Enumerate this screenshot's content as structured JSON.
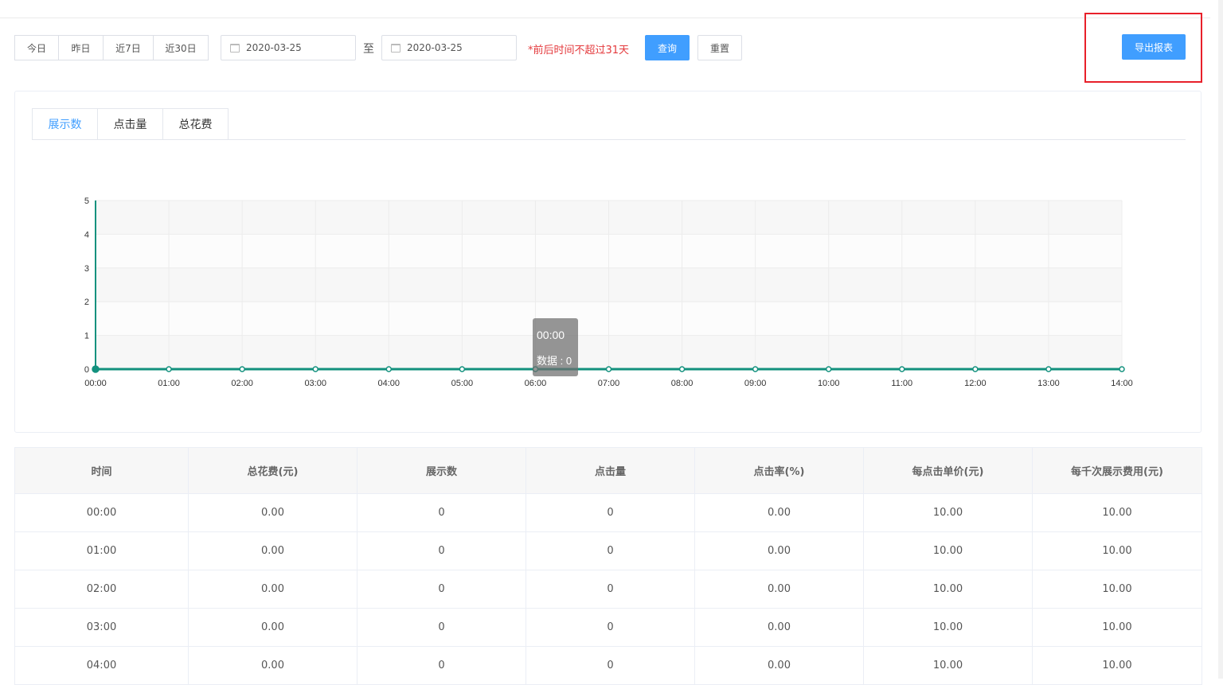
{
  "quick_dates": [
    "今日",
    "昨日",
    "近7日",
    "近30日"
  ],
  "date_range": {
    "start": "2020-03-25",
    "separator": "至",
    "end": "2020-03-25"
  },
  "warning": "*前后时间不超过31天",
  "buttons": {
    "query": "查询",
    "reset": "重置",
    "export": "导出报表"
  },
  "tabs": [
    {
      "label": "展示数",
      "active": true
    },
    {
      "label": "点击量",
      "active": false
    },
    {
      "label": "总花费",
      "active": false
    }
  ],
  "tooltip": {
    "time": "00:00",
    "label": "数据 : 0"
  },
  "chart_data": {
    "type": "line",
    "title": "",
    "xlabel": "",
    "ylabel": "",
    "x": [
      "00:00",
      "01:00",
      "02:00",
      "03:00",
      "04:00",
      "05:00",
      "06:00",
      "07:00",
      "08:00",
      "09:00",
      "10:00",
      "11:00",
      "12:00",
      "13:00",
      "14:00"
    ],
    "series": [
      {
        "values": [
          0,
          0,
          0,
          0,
          0,
          0,
          0,
          0,
          0,
          0,
          0,
          0,
          0,
          0,
          0
        ]
      }
    ],
    "y_ticks": [
      0,
      1,
      2,
      3,
      4,
      5
    ],
    "ylim": [
      0,
      5
    ],
    "grid": true,
    "color": "#13917e"
  },
  "table": {
    "columns": [
      "时间",
      "总花费(元)",
      "展示数",
      "点击量",
      "点击率(%)",
      "每点击单价(元)",
      "每千次展示费用(元)"
    ],
    "rows": [
      [
        "00:00",
        "0.00",
        "0",
        "0",
        "0.00",
        "10.00",
        "10.00"
      ],
      [
        "01:00",
        "0.00",
        "0",
        "0",
        "0.00",
        "10.00",
        "10.00"
      ],
      [
        "02:00",
        "0.00",
        "0",
        "0",
        "0.00",
        "10.00",
        "10.00"
      ],
      [
        "03:00",
        "0.00",
        "0",
        "0",
        "0.00",
        "10.00",
        "10.00"
      ],
      [
        "04:00",
        "0.00",
        "0",
        "0",
        "0.00",
        "10.00",
        "10.00"
      ]
    ]
  },
  "colors": {
    "primary": "#409eff",
    "warning": "#e4393c",
    "line": "#13917e",
    "highlight": "#e8202a"
  }
}
